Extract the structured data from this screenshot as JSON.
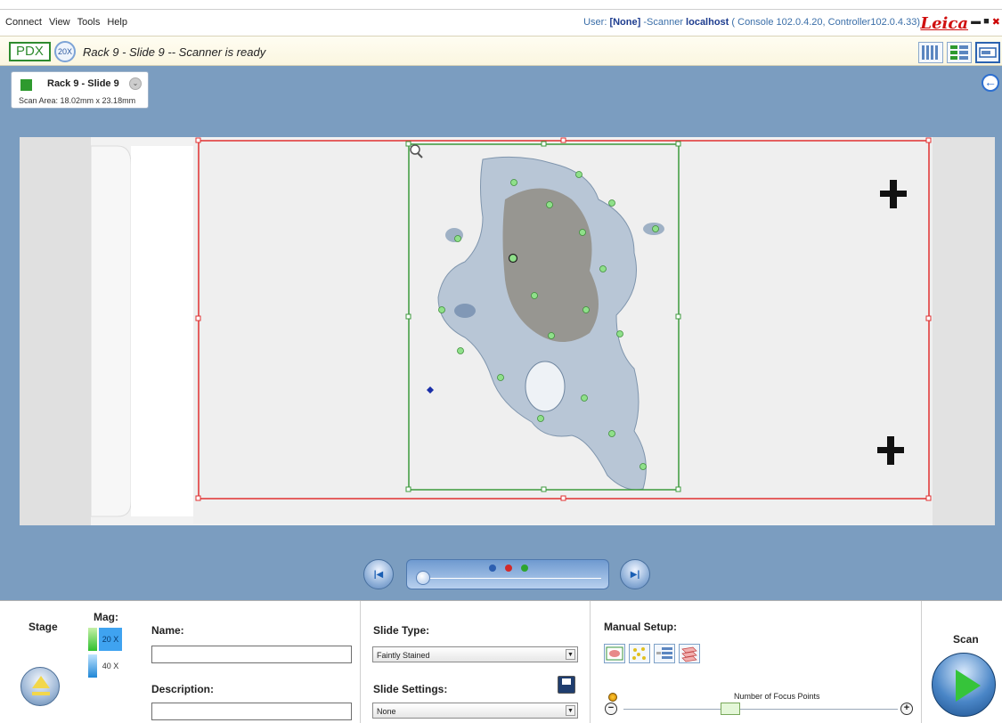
{
  "menu": {
    "items": [
      "Connect",
      "View",
      "Tools",
      "Help"
    ]
  },
  "header": {
    "user_label": "User:",
    "user_value": "[None]",
    "scanner_label": "-Scanner",
    "scanner_value": "localhost",
    "console_text": "( Console 102.0.4.20,",
    "controller_text": "Controller102.0.4.33)",
    "brand": "Leica",
    "window_controls": [
      "minimize",
      "maximize",
      "close"
    ]
  },
  "status": {
    "project": "PDX",
    "magnification": "20X",
    "message": "Rack 9 - Slide 9 -- Scanner is ready"
  },
  "view_buttons": [
    "slide-strip-view",
    "list-view",
    "single-slide-view"
  ],
  "slide_card": {
    "name": "Rack 9 - Slide 9",
    "scan_area": "Scan Area: 18.02mm x 23.18mm",
    "status_color": "#2e9a2e"
  },
  "navigation": {
    "prev_icon": "skip-previous-icon",
    "next_icon": "skip-next-icon",
    "dots": [
      "#2d5fb0",
      "#d22a2a",
      "#2ea52e"
    ]
  },
  "bottom": {
    "stage_label": "Stage",
    "mag_label": "Mag:",
    "mag_options": [
      "20 X",
      "40 X"
    ],
    "name_label": "Name:",
    "name_value": "",
    "description_label": "Description:",
    "description_value": "",
    "slide_type_label": "Slide Type:",
    "slide_type_value": "Faintly Stained",
    "slide_settings_label": "Slide Settings:",
    "slide_settings_value": "None",
    "manual_setup_label": "Manual Setup:",
    "focus_points_label": "Number of Focus Points",
    "focus_points_level": 0.39,
    "scan_label": "Scan"
  }
}
